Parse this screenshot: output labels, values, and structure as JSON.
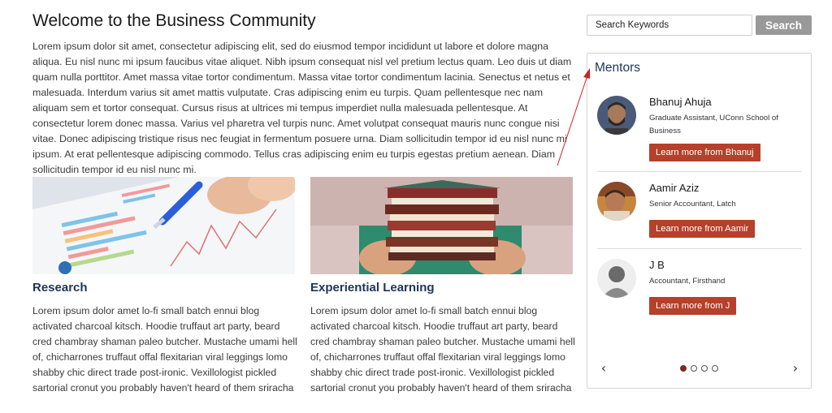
{
  "main": {
    "title": "Welcome to the Business Community",
    "intro": "Lorem ipsum dolor sit amet, consectetur adipiscing elit, sed do eiusmod tempor incididunt ut labore et dolore magna aliqua. Eu nisl nunc mi ipsum faucibus vitae aliquet. Nibh ipsum consequat nisl vel pretium lectus quam. Leo duis ut diam quam nulla porttitor. Amet massa vitae tortor condimentum. Massa vitae tortor condimentum lacinia. Senectus et netus et malesuada. Interdum varius sit amet mattis vulputate. Cras adipiscing enim eu turpis. Quam pellentesque nec nam aliquam sem et tortor consequat. Cursus risus at ultrices mi tempus imperdiet nulla malesuada pellentesque. At consectetur lorem donec massa. Varius vel pharetra vel turpis nunc. Amet volutpat consequat mauris nunc congue nisi vitae. Donec adipiscing tristique risus nec feugiat in fermentum posuere urna. Diam sollicitudin tempor id eu nisl nunc mi ipsum. At erat pellentesque adipiscing commodo. Tellus cras adipiscing enim eu turpis egestas pretium aenean. Diam sollicitudin tempor id eu nisl nunc mi.",
    "cards": [
      {
        "title": "Research",
        "text": "Lorem ipsum dolor amet lo-fi small batch ennui blog activated charcoal kitsch. Hoodie truffaut art party, beard cred chambray shaman paleo butcher. Mustache umami hell of, chicharrones truffaut offal flexitarian viral leggings lomo shabby chic direct trade post-ironic. Vexillologist pickled sartorial cronut you probably haven't heard of them sriracha"
      },
      {
        "title": "Experiential Learning",
        "text": "Lorem ipsum dolor amet lo-fi small batch ennui blog activated charcoal kitsch. Hoodie truffaut art party, beard cred chambray shaman paleo butcher. Mustache umami hell of, chicharrones truffaut offal flexitarian viral leggings lomo shabby chic direct trade post-ironic. Vexillologist pickled sartorial cronut you probably haven't heard of them sriracha"
      }
    ]
  },
  "search": {
    "placeholder": "Search Keywords",
    "button_label": "Search"
  },
  "mentors": {
    "title": "Mentors",
    "items": [
      {
        "name": "Bhanuj Ahuja",
        "role": "Graduate Assistant, UConn School of Business",
        "button": "Learn more from Bhanuj"
      },
      {
        "name": "Aamir Aziz",
        "role": "Senior Accountant, Latch",
        "button": "Learn more from Aamir"
      },
      {
        "name": "J B",
        "role": "Accountant, Firsthand",
        "button": "Learn more from J"
      }
    ],
    "pagination": {
      "current": 1,
      "total": 4
    }
  },
  "colors": {
    "accent_button": "#b5402b",
    "heading_blue": "#1d3557",
    "search_button": "#999999",
    "annotation_arrow": "#cc2222"
  },
  "icons": {
    "prev": "chevron-left-icon",
    "next": "chevron-right-icon"
  }
}
